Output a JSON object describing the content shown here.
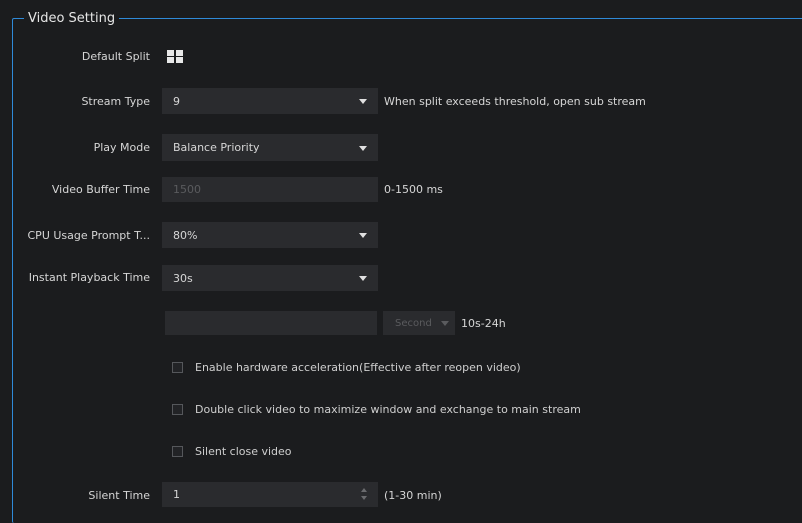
{
  "group": {
    "title": "Video Setting"
  },
  "default_split": {
    "label": "Default Split",
    "icon": "grid-2x2-icon"
  },
  "stream_type": {
    "label": "Stream Type",
    "value": "9",
    "hint": "When split exceeds threshold, open sub stream"
  },
  "play_mode": {
    "label": "Play Mode",
    "value": "Balance Priority"
  },
  "video_buffer": {
    "label": "Video Buffer Time",
    "placeholder": "1500",
    "hint": "0-1500 ms"
  },
  "cpu_usage": {
    "label": "CPU Usage Prompt T...",
    "value": "80%"
  },
  "instant_playback": {
    "label": "Instant Playback Time",
    "value": "30s"
  },
  "custom_time": {
    "value": "",
    "unit": "Second",
    "hint": "10s-24h"
  },
  "options": [
    {
      "label": "Enable hardware acceleration(Effective after reopen video)",
      "checked": false
    },
    {
      "label": "Double click video to maximize window and exchange to main stream",
      "checked": false
    },
    {
      "label": "Silent close video",
      "checked": false
    }
  ],
  "silent_time": {
    "label": "Silent Time",
    "value": "1",
    "hint": "(1-30 min)"
  }
}
